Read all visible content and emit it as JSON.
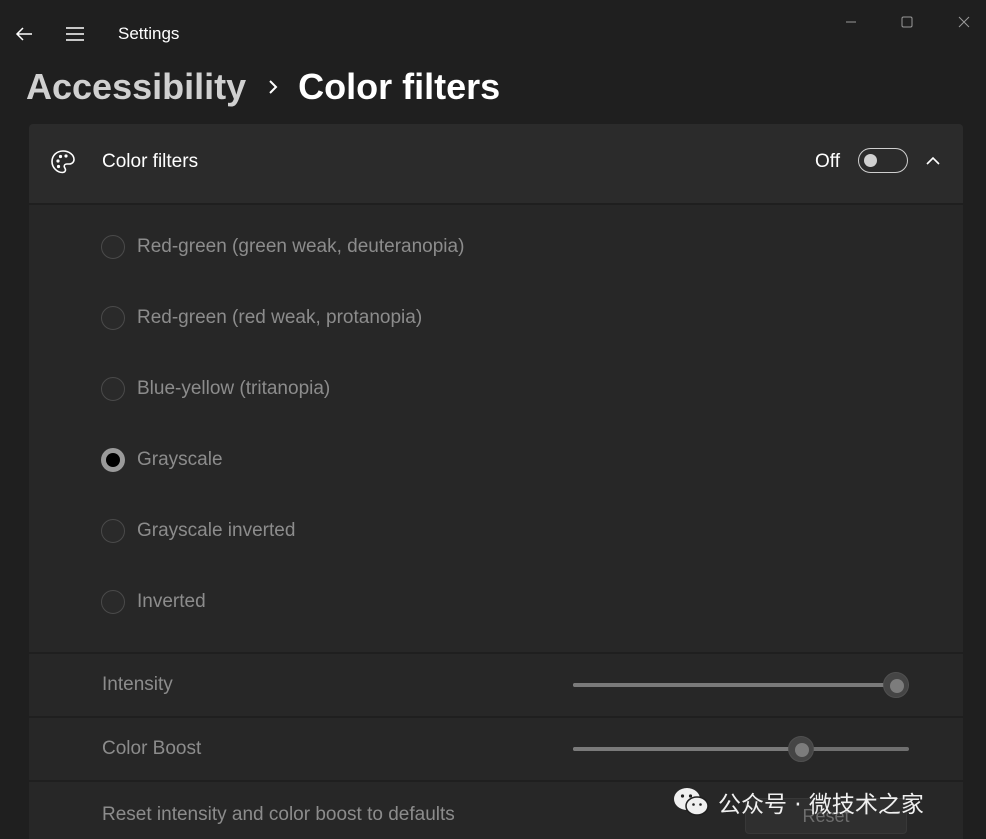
{
  "app": {
    "title": "Settings"
  },
  "breadcrumb": {
    "parent": "Accessibility",
    "current": "Color filters"
  },
  "colors": {
    "background": "#1f1f1f",
    "card": "#2b2b2b",
    "panel": "#272727",
    "disabled_text": "#8c8c8c"
  },
  "color_filters": {
    "header_label": "Color filters",
    "header_icon": "palette-icon",
    "toggle": {
      "state_label": "Off",
      "on": false
    },
    "options": [
      {
        "label": "Red-green (green weak, deuteranopia)",
        "checked": false
      },
      {
        "label": "Red-green (red weak, protanopia)",
        "checked": false
      },
      {
        "label": "Blue-yellow (tritanopia)",
        "checked": false
      },
      {
        "label": "Grayscale",
        "checked": true
      },
      {
        "label": "Grayscale inverted",
        "checked": false
      },
      {
        "label": "Inverted",
        "checked": false
      }
    ]
  },
  "intensity": {
    "label": "Intensity",
    "value_percent": 96
  },
  "color_boost": {
    "label": "Color Boost",
    "value_percent": 68
  },
  "reset": {
    "label": "Reset intensity and color boost to defaults",
    "button_label": "Reset"
  },
  "watermark": {
    "text": "公众号 · 微技术之家"
  }
}
